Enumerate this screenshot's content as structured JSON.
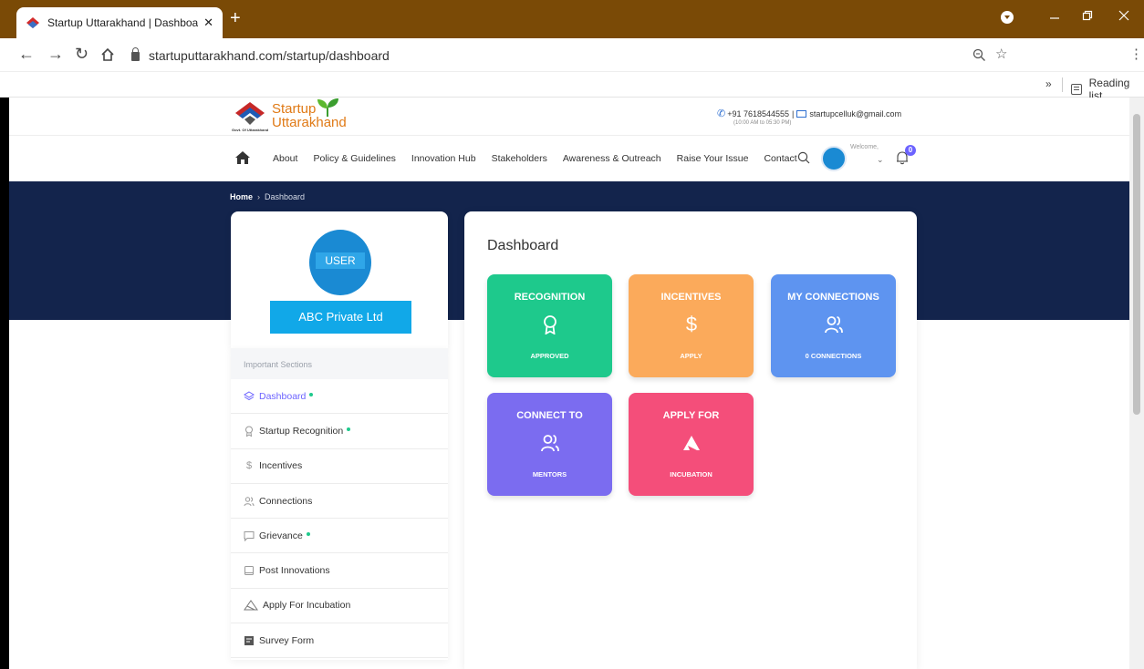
{
  "browser": {
    "tab_title": "Startup Uttarakhand | Dashboard",
    "tab_close": "✕",
    "new_tab": "+",
    "url": "startuputtarakhand.com/startup/dashboard",
    "bookmarks_overflow": "»",
    "reading_list": "Reading list"
  },
  "site": {
    "logo_line1": "Startup",
    "logo_line2": "Uttarakhand",
    "logo_govt": "Govt. Of Uttarakhand",
    "phone": "+91 7618544555",
    "separator": "|",
    "email": "startupcelluk@gmail.com",
    "hours": "(10:00 AM to 05:30 PM)",
    "welcome": "Welcome,",
    "notif_count": "0",
    "nav": [
      "About",
      "Policy & Guidelines",
      "Innovation Hub",
      "Stakeholders",
      "Awareness & Outreach",
      "Raise Your Issue",
      "Contact"
    ]
  },
  "breadcrumb": {
    "home": "Home",
    "sep": "›",
    "current": "Dashboard"
  },
  "profile": {
    "avatar_label": "USER",
    "company": "ABC Private Ltd"
  },
  "menu": {
    "header": "Important Sections",
    "items": [
      {
        "label": "Dashboard",
        "icon": "layers-icon",
        "dot": true
      },
      {
        "label": "Startup Recognition",
        "icon": "award-icon",
        "dot": true
      },
      {
        "label": "Incentives",
        "icon": "dollar-icon",
        "dot": false
      },
      {
        "label": "Connections",
        "icon": "users-icon",
        "dot": false
      },
      {
        "label": "Grievance",
        "icon": "message-icon",
        "dot": true
      },
      {
        "label": "Post Innovations",
        "icon": "note-icon",
        "dot": false
      },
      {
        "label": "Apply For Incubation",
        "icon": "incubation-icon",
        "dot": false
      },
      {
        "label": "Survey Form",
        "icon": "survey-icon",
        "dot": false
      }
    ]
  },
  "dashboard": {
    "title": "Dashboard",
    "tiles": [
      {
        "title": "RECOGNITION",
        "sub": "APPROVED",
        "color": "#1ec98c",
        "icon": "award-icon"
      },
      {
        "title": "INCENTIVES",
        "sub": "APPLY",
        "color": "#fbaa5b",
        "icon": "dollar-icon"
      },
      {
        "title": "MY CONNECTIONS",
        "sub": "0 CONNECTIONS",
        "color": "#5e94f0",
        "icon": "users-icon"
      },
      {
        "title": "CONNECT TO",
        "sub": "MENTORS",
        "color": "#7b6cf0",
        "icon": "users-icon"
      },
      {
        "title": "APPLY FOR",
        "sub": "INCUBATION",
        "color": "#f44e7a",
        "icon": "incubation-icon"
      }
    ]
  },
  "colors": {
    "tab_bar": "#7a4a06",
    "hero": "#13244c",
    "accent": "#6c63ff",
    "company_button": "#11a8e8"
  }
}
